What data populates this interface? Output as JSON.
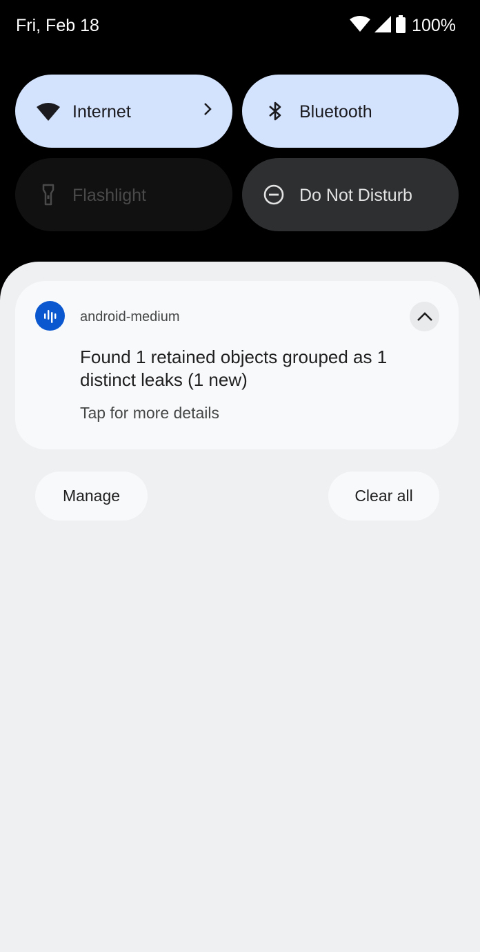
{
  "status_bar": {
    "date": "Fri, Feb 18",
    "battery": "100%",
    "icons": [
      "wifi-icon",
      "cellular-signal-icon",
      "battery-icon"
    ]
  },
  "quick_settings": {
    "tiles": [
      {
        "label": "Internet",
        "icon": "wifi-icon",
        "state": "on"
      },
      {
        "label": "Bluetooth",
        "icon": "bluetooth-icon",
        "state": "on"
      },
      {
        "label": "Flashlight",
        "icon": "flashlight-icon",
        "state": "unavailable"
      },
      {
        "label": "Do Not Disturb",
        "icon": "do-not-disturb-icon",
        "state": "off"
      }
    ]
  },
  "notification": {
    "app_name": "android-medium",
    "app_icon": "audio-waveform-icon",
    "title": "Found 1 retained objects grouped as 1 distinct leaks (1 new)",
    "text": "Tap for more details"
  },
  "actions": {
    "manage": "Manage",
    "clear_all": "Clear all"
  },
  "colors": {
    "tile_on": "#d3e3fd",
    "tile_off": "#2d2f31",
    "accent": "#0b57d0",
    "shade_bg": "#eff0f2"
  }
}
